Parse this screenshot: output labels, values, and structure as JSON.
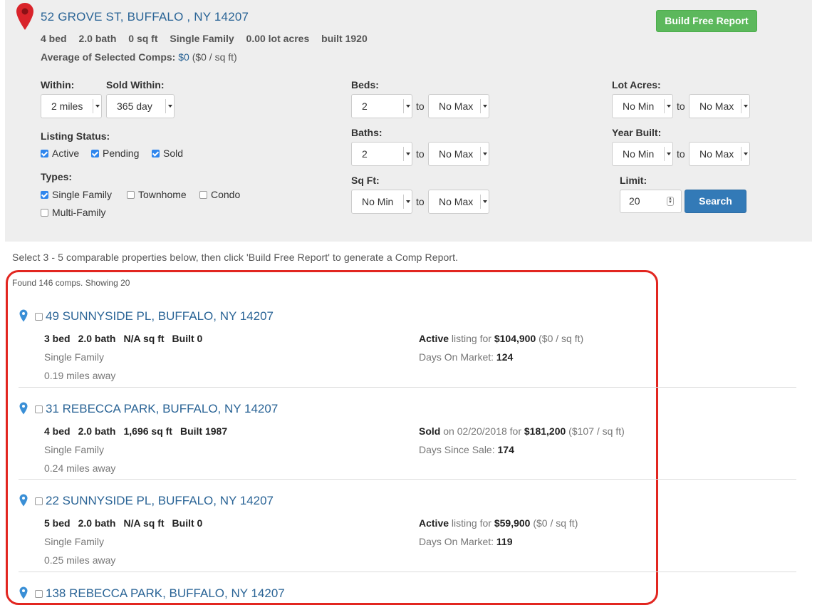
{
  "subject": {
    "address": "52 GROVE ST, BUFFALO , NY 14207",
    "beds": "4 bed",
    "baths": "2.0 bath",
    "sqft": "0 sq ft",
    "type": "Single Family",
    "lot": "0.00 lot acres",
    "built": "built 1920",
    "avg_label": "Average of Selected Comps:",
    "avg_value": "$0",
    "avg_per_sqft": "($0 / sq ft)",
    "build_button": "Build Free Report"
  },
  "filters": {
    "within_label": "Within:",
    "within_value": "2 miles",
    "sold_within_label": "Sold Within:",
    "sold_within_value": "365 day",
    "listing_status_label": "Listing Status:",
    "status_options": [
      {
        "label": "Active",
        "checked": true
      },
      {
        "label": "Pending",
        "checked": true
      },
      {
        "label": "Sold",
        "checked": true
      }
    ],
    "types_label": "Types:",
    "type_options": [
      {
        "label": "Single Family",
        "checked": true
      },
      {
        "label": "Townhome",
        "checked": false
      },
      {
        "label": "Condo",
        "checked": false
      },
      {
        "label": "Multi-Family",
        "checked": false
      }
    ],
    "beds_label": "Beds:",
    "beds_min": "2",
    "beds_max": "No Max",
    "baths_label": "Baths:",
    "baths_min": "2",
    "baths_max": "No Max",
    "sqft_label": "Sq Ft:",
    "sqft_min": "No Min",
    "sqft_max": "No Max",
    "lot_label": "Lot Acres:",
    "lot_min": "No Min",
    "lot_max": "No Max",
    "year_label": "Year Built:",
    "year_min": "No Min",
    "year_max": "No Max",
    "limit_label": "Limit:",
    "limit_value": "20",
    "to_text": "to",
    "search_button": "Search"
  },
  "instructions": "Select 3 - 5 comparable properties below, then click 'Build Free Report' to generate a Comp Report.",
  "found_text": "Found 146 comps. Showing 20",
  "colors": {
    "link": "#2a6496",
    "build": "#5cb85c",
    "search": "#337ab7",
    "highlight": "#e22620",
    "pin": "#d9232a",
    "comp_pin": "#3a8fd6"
  },
  "comps": [
    {
      "address": "49 SUNNYSIDE PL, BUFFALO, NY 14207",
      "beds": "3 bed",
      "baths": "2.0 bath",
      "sqft": "N/A sq ft",
      "built": "Built 0",
      "type": "Single Family",
      "distance": "0.19 miles away",
      "status": "Active",
      "status_text": " listing for ",
      "price": "$104,900",
      "per_sqft": " ($0 / sq ft)",
      "days_label": "Days On Market: ",
      "days": "124"
    },
    {
      "address": "31 REBECCA PARK, BUFFALO, NY 14207",
      "beds": "4 bed",
      "baths": "2.0 bath",
      "sqft": "1,696 sq ft",
      "built": "Built 1987",
      "type": "Single Family",
      "distance": "0.24 miles away",
      "status": "Sold",
      "status_text": " on 02/20/2018 for ",
      "price": "$181,200",
      "per_sqft": " ($107 / sq ft)",
      "days_label": "Days Since Sale: ",
      "days": "174"
    },
    {
      "address": "22 SUNNYSIDE PL, BUFFALO, NY 14207",
      "beds": "5 bed",
      "baths": "2.0 bath",
      "sqft": "N/A sq ft",
      "built": "Built 0",
      "type": "Single Family",
      "distance": "0.25 miles away",
      "status": "Active",
      "status_text": " listing for ",
      "price": "$59,900",
      "per_sqft": " ($0 / sq ft)",
      "days_label": "Days On Market: ",
      "days": "119"
    },
    {
      "address": "138 REBECCA PARK, BUFFALO, NY 14207"
    }
  ]
}
